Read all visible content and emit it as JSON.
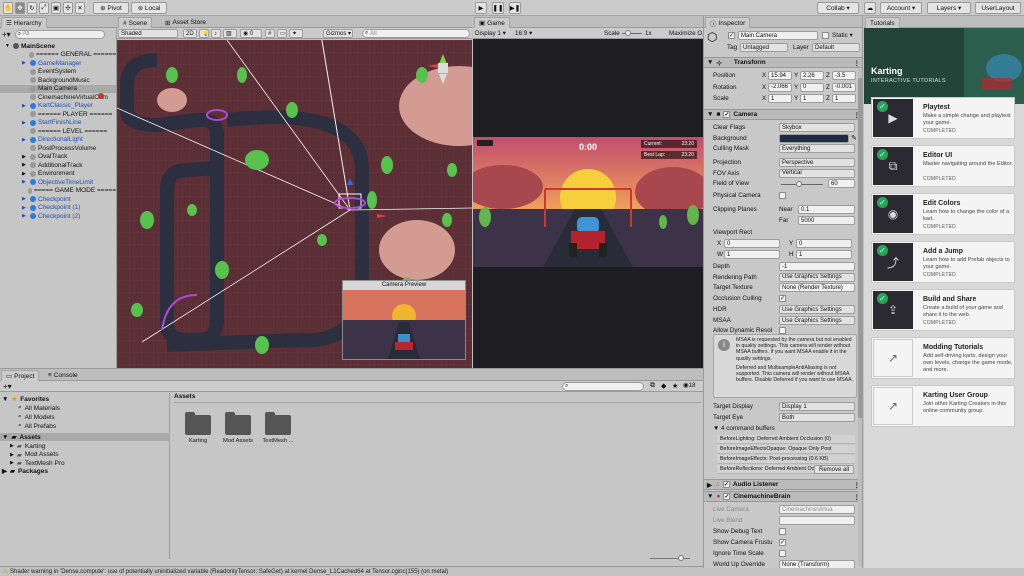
{
  "toolbar": {
    "pivot_label": "Pivot",
    "local_label": "Local",
    "collab_label": "Collab ▾",
    "account_label": "Account",
    "layers_label": "Layers",
    "layout_label": "UserLayout"
  },
  "hierarchy": {
    "tab_label": "Hierarchy",
    "search_placeholder": "All",
    "items": [
      {
        "label": "MainScene",
        "indent": 0,
        "color": "black",
        "arrow": "▼"
      },
      {
        "label": "====== GENERAL ======",
        "indent": 1,
        "color": "black"
      },
      {
        "label": "GameManager",
        "indent": 1,
        "color": "blue",
        "arrow": "▶"
      },
      {
        "label": "EventSystem",
        "indent": 1,
        "color": "black"
      },
      {
        "label": "BackgroundMusic",
        "indent": 1,
        "color": "black"
      },
      {
        "label": "Main Camera",
        "indent": 1,
        "color": "black",
        "selected": true
      },
      {
        "label": "CinemachineVirtualCam",
        "indent": 1,
        "color": "black"
      },
      {
        "label": "KartClassic_Player",
        "indent": 1,
        "color": "blue",
        "arrow": "▶"
      },
      {
        "label": "====== PLAYER ======",
        "indent": 1,
        "color": "black"
      },
      {
        "label": "StartFinishLine",
        "indent": 1,
        "color": "blue",
        "arrow": "▶"
      },
      {
        "label": "====== LEVEL ======",
        "indent": 1,
        "color": "black"
      },
      {
        "label": "DirectionalLight",
        "indent": 1,
        "color": "blue",
        "arrow": "▶"
      },
      {
        "label": "PostProcessVolume",
        "indent": 1,
        "color": "black"
      },
      {
        "label": "OvalTrack",
        "indent": 1,
        "color": "black",
        "arrow": "▶"
      },
      {
        "label": "AdditionalTrack",
        "indent": 1,
        "color": "black",
        "arrow": "▶"
      },
      {
        "label": "Environment",
        "indent": 1,
        "color": "black",
        "arrow": "▶"
      },
      {
        "label": "ObjectiveTimeLimit",
        "indent": 1,
        "color": "blue",
        "arrow": "▶"
      },
      {
        "label": "===== GAME MODE =====",
        "indent": 1,
        "color": "black"
      },
      {
        "label": "Checkpoint",
        "indent": 1,
        "color": "blue",
        "arrow": "▶"
      },
      {
        "label": "Checkpoint (1)",
        "indent": 1,
        "color": "blue",
        "arrow": "▶"
      },
      {
        "label": "Checkpoint (2)",
        "indent": 1,
        "color": "blue",
        "arrow": "▶"
      }
    ]
  },
  "scene": {
    "tab_scene": "Scene",
    "tab_asset_store": "Asset Store",
    "shading_mode": "Shaded",
    "mode_2d": "2D",
    "gizmos_label": "Gizmos ▾",
    "search_placeholder": "All",
    "light_count": "0",
    "camera_preview_title": "Camera Preview"
  },
  "game": {
    "tab_label": "Game",
    "display": "Display 1",
    "aspect": "16:9",
    "scale_label": "Scale",
    "scale_value": "1x",
    "maximize_label": "Maximize O",
    "timer": "0:00",
    "current_label": "Current:",
    "current_value": "23:20",
    "best_label": "Best Lap:",
    "best_value": "23:20"
  },
  "inspector": {
    "tab_label": "Inspector",
    "object_name": "Main Camera",
    "static_label": "Static ▾",
    "tag_label": "Tag",
    "tag_value": "Untagged",
    "layer_label": "Layer",
    "layer_value": "Default",
    "transform": {
      "title": "Transform",
      "position_label": "Position",
      "position": [
        "15.94",
        "2.26",
        "-3.5"
      ],
      "rotation_label": "Rotation",
      "rotation": [
        "-2.066",
        "0",
        "-0.001"
      ],
      "scale_label": "Scale",
      "scale": [
        "1",
        "1",
        "1"
      ]
    },
    "camera": {
      "title": "Camera",
      "fields": [
        {
          "label": "Clear Flags",
          "value": "Skybox",
          "type": "drop"
        },
        {
          "label": "Background",
          "value": "",
          "type": "color"
        },
        {
          "label": "Culling Mask",
          "value": "Everything",
          "type": "drop"
        },
        {
          "label": "Projection",
          "value": "Perspective",
          "type": "drop"
        },
        {
          "label": "FOV Axis",
          "value": "Vertical",
          "type": "drop"
        },
        {
          "label": "Field of View",
          "value": "60",
          "type": "slider"
        },
        {
          "label": "Physical Camera",
          "value": "",
          "type": "check"
        },
        {
          "label": "Clipping Planes",
          "near_label": "Near",
          "near": "0.1",
          "far_label": "Far",
          "far": "5000",
          "type": "clip"
        },
        {
          "label": "Viewport Rect",
          "x": "0",
          "y": "0",
          "w": "1",
          "h": "1",
          "type": "rect"
        },
        {
          "label": "Depth",
          "value": "-1",
          "type": "text"
        },
        {
          "label": "Rendering Path",
          "value": "Use Graphics Settings",
          "type": "drop"
        },
        {
          "label": "Target Texture",
          "value": "None (Render Texture)",
          "type": "obj"
        },
        {
          "label": "Occlusion Culling",
          "value": "✓",
          "type": "check"
        },
        {
          "label": "HDR",
          "value": "Use Graphics Settings",
          "type": "drop"
        },
        {
          "label": "MSAA",
          "value": "Use Graphics Settings",
          "type": "drop"
        },
        {
          "label": "Allow Dynamic Resol",
          "value": "",
          "type": "check"
        }
      ],
      "info_text_1": "MSAA is requested by the camera but not enabled in quality settings. This camera will render without MSAA buffers. If you want MSAA enable it in the quality settings.",
      "info_text_2": "Deferred and MultisampleAntiAliasing is not supported. This camera will render without MSAA buffers. Disable Deferred if you want to use MSAA.",
      "target_display_label": "Target Display",
      "target_display_value": "Display 1",
      "target_eye_label": "Target Eye",
      "target_eye_value": "Both",
      "command_buffers_label": "4 command buffers",
      "command_buffers": [
        "BeforeLighting: Deferred Ambient Occlusion (0)",
        "BeforeImageEffectsOpaque: Opaque Only Post",
        "BeforeImageEffects: Post-processing (0.6 KB)",
        "BeforeReflections: Deferred Ambient Occlusion"
      ],
      "remove_all_label": "Remove all"
    },
    "audio_listener": {
      "title": "Audio Listener"
    },
    "cinemachine": {
      "title": "CinemachineBrain",
      "live_camera_label": "Live Camera",
      "live_camera_value": "CinemachineVirtua",
      "live_blend_label": "Live Blend",
      "show_debug_label": "Show Debug Text",
      "show_frustum_label": "Show Camera Frustu",
      "ignore_time_label": "Ignore Time Scale",
      "world_up_label": "World Up Override",
      "world_up_value": "None (Transform)"
    }
  },
  "tutorials": {
    "tab_label": "Tutorials",
    "title": "Karting",
    "subtitle": "INTERACTIVE TUTORIALS",
    "cards": [
      {
        "title": "Playtest",
        "desc": "Make a simple change and playtest your game.",
        "badge": "COMPLETED",
        "completed": true
      },
      {
        "title": "Editor UI",
        "desc": "Master navigating around the Editor.",
        "badge": "COMPLETED",
        "completed": true
      },
      {
        "title": "Edit Colors",
        "desc": "Learn how to change the color of a kart.",
        "badge": "COMPLETED",
        "completed": true
      },
      {
        "title": "Add a Jump",
        "desc": "Learn how to add Prefab objects to your game.",
        "badge": "COMPLETED",
        "completed": true
      },
      {
        "title": "Build and Share",
        "desc": "Create a build of your game and share it to the web.",
        "badge": "COMPLETED",
        "completed": true
      },
      {
        "title": "Modding Tutorials",
        "desc": "Add self-driving karts, design your own levels, change the game mode, and more.",
        "badge": "",
        "completed": false
      },
      {
        "title": "Karting User Group",
        "desc": "Join other Karting Creators in this online community group.",
        "badge": "",
        "completed": false
      }
    ]
  },
  "project": {
    "tab_project": "Project",
    "tab_console": "Console",
    "hidden_count": "18",
    "favorites_label": "Favorites",
    "favorites": [
      "All Materials",
      "All Models",
      "All Prefabs"
    ],
    "assets_label": "Assets",
    "asset_folders": [
      "Karting",
      "Mod Assets",
      "TextMesh Pro"
    ],
    "packages_label": "Packages",
    "breadcrumb": "Assets",
    "grid_items": [
      "Karting",
      "Mod Assets",
      "TextMesh ..."
    ]
  },
  "status_bar": {
    "message": "Shader warning in 'Dense.compute': use of potentially uninitialized variable (ReadonlyTensor::SafeGet) at kernel Dense_L1Cached64 at Tensor.cginc(155) (on metal)"
  }
}
